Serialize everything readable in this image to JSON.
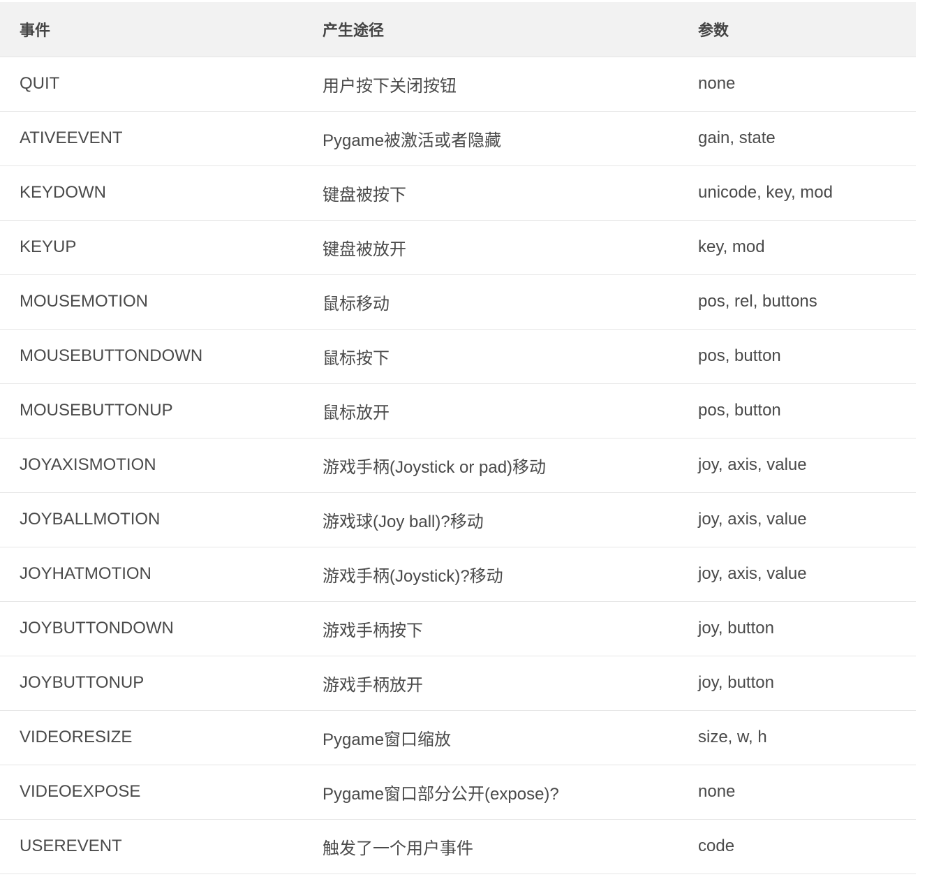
{
  "table": {
    "headers": [
      "事件",
      "产生途径",
      "参数"
    ],
    "rows": [
      [
        "QUIT",
        "用户按下关闭按钮",
        "none"
      ],
      [
        "ATIVEEVENT",
        "Pygame被激活或者隐藏",
        "gain, state"
      ],
      [
        "KEYDOWN",
        "键盘被按下",
        "unicode, key, mod"
      ],
      [
        "KEYUP",
        "键盘被放开",
        "key, mod"
      ],
      [
        "MOUSEMOTION",
        "鼠标移动",
        "pos, rel, buttons"
      ],
      [
        "MOUSEBUTTONDOWN",
        "鼠标按下",
        "pos, button"
      ],
      [
        "MOUSEBUTTONUP",
        "鼠标放开",
        "pos, button"
      ],
      [
        "JOYAXISMOTION",
        "游戏手柄(Joystick or pad)移动",
        "joy, axis, value"
      ],
      [
        "JOYBALLMOTION",
        "游戏球(Joy ball)?移动",
        "joy, axis, value"
      ],
      [
        "JOYHATMOTION",
        "游戏手柄(Joystick)?移动",
        "joy, axis, value"
      ],
      [
        "JOYBUTTONDOWN",
        "游戏手柄按下",
        "joy, button"
      ],
      [
        "JOYBUTTONUP",
        "游戏手柄放开",
        "joy, button"
      ],
      [
        "VIDEORESIZE",
        "Pygame窗口缩放",
        "size, w, h"
      ],
      [
        "VIDEOEXPOSE",
        "Pygame窗口部分公开(expose)?",
        "none"
      ],
      [
        "USEREVENT",
        "触发了一个用户事件",
        "code"
      ]
    ]
  }
}
